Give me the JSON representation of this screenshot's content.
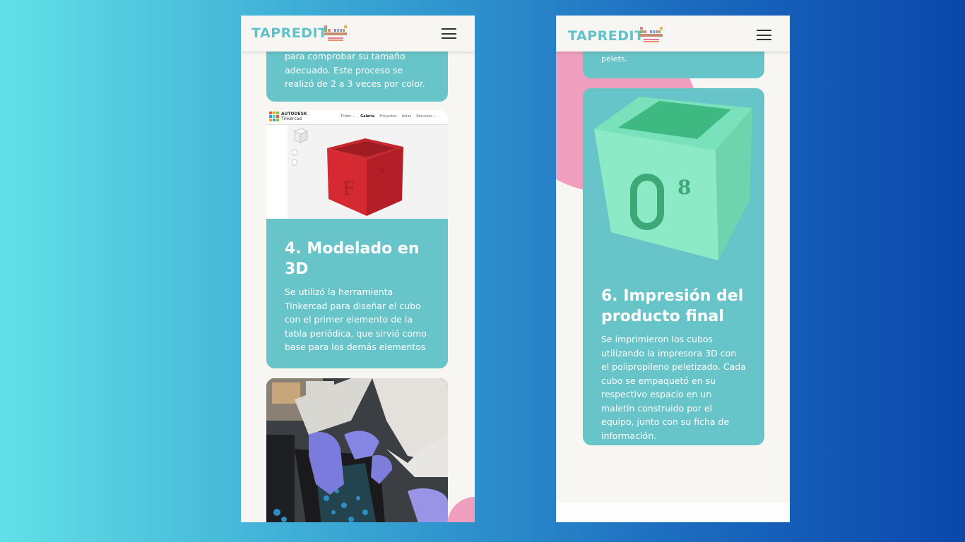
{
  "brand": "TAPREDIT",
  "left": {
    "partial_top": "para comprobar su tamaño",
    "top_card_text": "adecuado. Este proceso se realizó de 2 a 3 veces por color.",
    "screenshot": {
      "brand_line1": "AUTODESK",
      "brand_line2": "Tinkercad",
      "nav": [
        "Tinker ⌄",
        "Galería",
        "Proyectos",
        "Aulas",
        "Recursos ⌄"
      ]
    },
    "section_title": "4. Modelado en 3D",
    "section_text": "Se utilizó la herramienta Tinkercad para diseñar el cubo con el primer elemento de la tabla periódica, que sirvió como base para los demás elementos"
  },
  "right": {
    "partial_top": "pelets.",
    "section_title": "6. Impresión del producto final",
    "section_text": "Se imprimieron los cubos utilizando la impresora 3D con el polipropileno peletizado. Cada cubo se empaquetó en su respectivo espacio en un maletín construido por el equipo, junto con su ficha de información.",
    "cube_big": "O",
    "cube_small": "8"
  },
  "colors": {
    "teal_card": "#67c4c8",
    "brand": "#5ec2c8",
    "pink": "#ef9fbd",
    "page_bg": "#f8f6f3"
  }
}
